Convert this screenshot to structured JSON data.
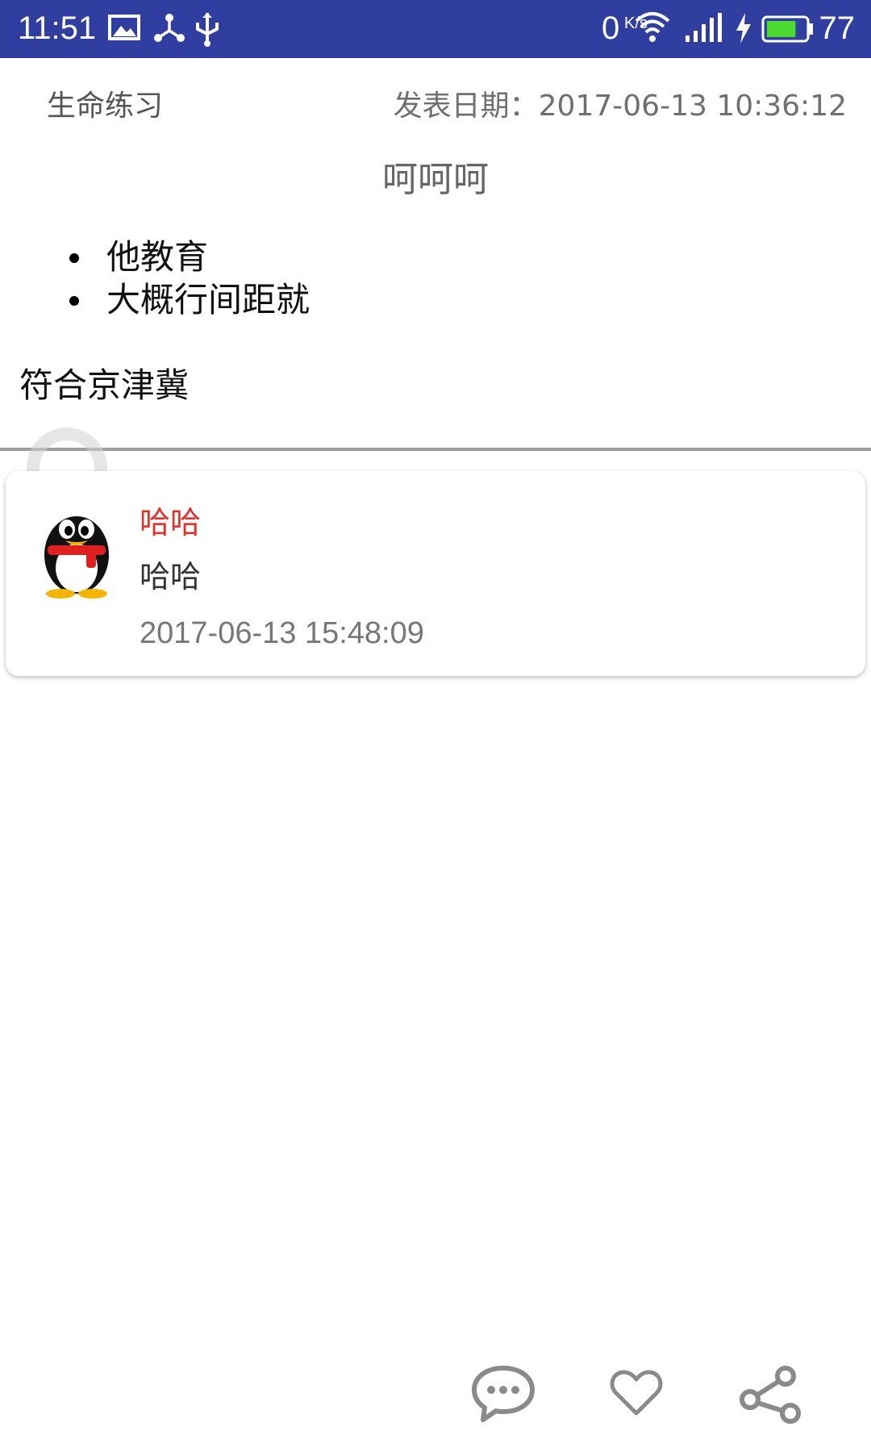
{
  "status_bar": {
    "time": "11:51",
    "net_speed": "0",
    "net_unit": "K/s",
    "battery": "77",
    "background_color": "#303F9F",
    "battery_color": "#4CDA32",
    "icons": [
      "gallery-icon",
      "share-nodes-icon",
      "usb-icon",
      "wifi-icon",
      "signal-icon",
      "charging-icon",
      "battery-icon"
    ]
  },
  "article": {
    "category": "生命练习",
    "publish_label": "发表日期：",
    "publish_date": "2017-06-13 10:36:12",
    "title": "呵呵呵",
    "bullets": [
      "他教育",
      "大概行间距就"
    ],
    "paragraph": "符合京津冀"
  },
  "comments": [
    {
      "user": "哈哈",
      "text": "哈哈",
      "time": "2017-06-13 15:48:09",
      "avatar_icon": "qq-penguin-icon",
      "user_color": "#e0312b"
    }
  ],
  "actions": {
    "icons": [
      "comment-icon",
      "like-heart-icon",
      "share-icon"
    ],
    "icon_color": "#8a8a8a"
  }
}
